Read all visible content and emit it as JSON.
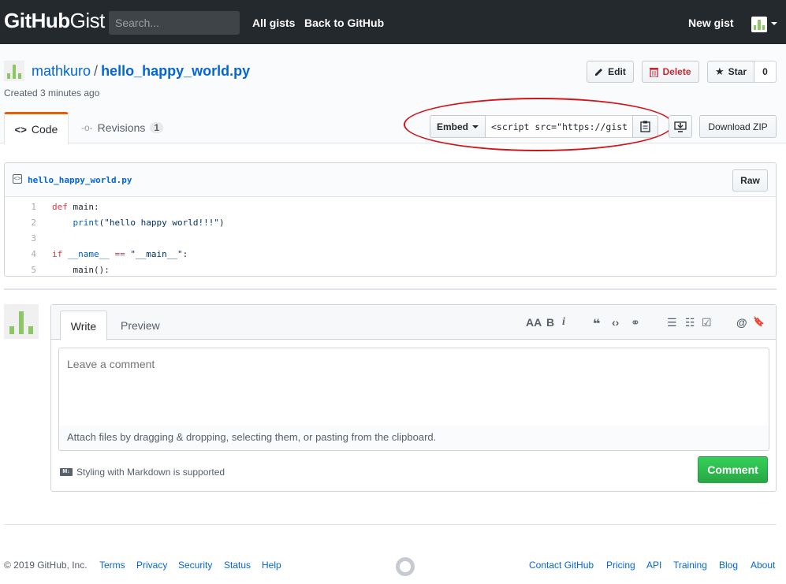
{
  "header": {
    "logo_bold": "GitHub",
    "logo_light": "Gist",
    "search_placeholder": "Search...",
    "nav": [
      "All gists",
      "Back to GitHub"
    ],
    "new_gist": "New gist"
  },
  "gist": {
    "owner": "mathkuro",
    "separator": "/",
    "filename": "hello_happy_world.py",
    "created": "Created 3 minutes ago"
  },
  "actions": {
    "edit": "Edit",
    "delete": "Delete",
    "star": "Star",
    "star_count": "0",
    "embed": "Embed",
    "embed_value": "<script src=\"https://gist.",
    "download": "Download ZIP"
  },
  "tabs": {
    "code": "Code",
    "revisions": "Revisions",
    "revisions_count": "1"
  },
  "file": {
    "name": "hello_happy_world.py",
    "raw": "Raw",
    "lines": [
      {
        "n": "1",
        "parts": [
          {
            "t": "def",
            "c": "kw"
          },
          {
            "t": " main:",
            "c": ""
          }
        ]
      },
      {
        "n": "2",
        "parts": [
          {
            "t": "    ",
            "c": ""
          },
          {
            "t": "print",
            "c": "nb"
          },
          {
            "t": "(",
            "c": ""
          },
          {
            "t": "\"hello happy world!!!\"",
            "c": "st"
          },
          {
            "t": ")",
            "c": ""
          }
        ]
      },
      {
        "n": "3",
        "parts": []
      },
      {
        "n": "4",
        "parts": [
          {
            "t": "if",
            "c": "kw"
          },
          {
            "t": " ",
            "c": ""
          },
          {
            "t": "__name__",
            "c": "nb"
          },
          {
            "t": " ",
            "c": ""
          },
          {
            "t": "==",
            "c": "kw"
          },
          {
            "t": " ",
            "c": ""
          },
          {
            "t": "\"__main__\"",
            "c": "st"
          },
          {
            "t": ":",
            "c": ""
          }
        ]
      },
      {
        "n": "5",
        "parts": [
          {
            "t": "    main():",
            "c": ""
          }
        ]
      }
    ]
  },
  "comment": {
    "write_tab": "Write",
    "preview_tab": "Preview",
    "toolbar": [
      "AA",
      "B",
      "i",
      "❝",
      "‹›",
      "⚭",
      "☰",
      "☷",
      "☑",
      "@",
      "🔖"
    ],
    "placeholder": "Leave a comment",
    "attach": "Attach files by dragging & dropping, selecting them, or pasting from the clipboard.",
    "markdown": "Styling with Markdown is supported",
    "submit": "Comment"
  },
  "footer": {
    "copyright": "© 2019 GitHub, Inc.",
    "left_links": [
      "Terms",
      "Privacy",
      "Security",
      "Status",
      "Help"
    ],
    "right_links": [
      "Contact GitHub",
      "Pricing",
      "API",
      "Training",
      "Blog",
      "About"
    ]
  },
  "colors": {
    "header_bg": "#24292e",
    "link": "#0366d6",
    "accent_tab": "#e36209",
    "comment_button": "#28a745",
    "danger": "#cb2431",
    "identicon": "#8cc665",
    "annotation_ring": "#d0161b"
  }
}
